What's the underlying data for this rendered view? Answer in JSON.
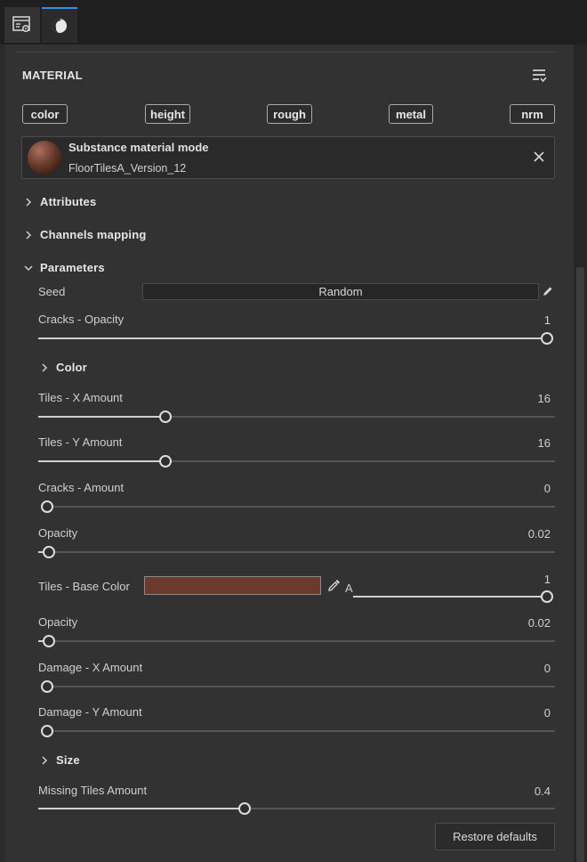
{
  "tabs": [
    {
      "name": "properties-icon"
    },
    {
      "name": "shader-icon"
    }
  ],
  "header": {
    "title": "MATERIAL",
    "menu_icon": "list-menu-icon"
  },
  "channel_chips": [
    "color",
    "height",
    "rough",
    "metal",
    "nrm"
  ],
  "material": {
    "mode_title": "Substance material mode",
    "name": "FloorTilesA_Version_12"
  },
  "sections": {
    "attributes": "Attributes",
    "channels_mapping": "Channels mapping",
    "parameters": "Parameters",
    "color": "Color",
    "size": "Size"
  },
  "seed": {
    "label": "Seed",
    "button": "Random"
  },
  "params": {
    "cracks_opacity": {
      "label": "Cracks - Opacity",
      "value": "1",
      "fraction": 1.0
    },
    "tiles_x": {
      "label": "Tiles - X Amount",
      "value": "16",
      "fraction": 0.246
    },
    "tiles_y": {
      "label": "Tiles - Y Amount",
      "value": "16",
      "fraction": 0.246
    },
    "cracks_amount": {
      "label": "Cracks - Amount",
      "value": "0",
      "fraction": 0.0
    },
    "opacity_1": {
      "label": "Opacity",
      "value": "0.02",
      "fraction": 0.02
    },
    "base_color": {
      "label": "Tiles - Base Color",
      "alpha_label": "A",
      "alpha_value": "1",
      "alpha_fraction": 1.0,
      "color": "#6b3a2c"
    },
    "opacity_2": {
      "label": "Opacity",
      "value": "0.02",
      "fraction": 0.02
    },
    "damage_x": {
      "label": "Damage - X Amount",
      "value": "0",
      "fraction": 0.0
    },
    "damage_y": {
      "label": "Damage - Y Amount",
      "value": "0",
      "fraction": 0.0
    },
    "missing_tiles": {
      "label": "Missing Tiles Amount",
      "value": "0.4",
      "fraction": 0.4
    }
  },
  "restore_label": "Restore defaults",
  "colors": {
    "accent": "#3a8ee6",
    "panel": "#323232",
    "background": "#2b2b2b"
  }
}
